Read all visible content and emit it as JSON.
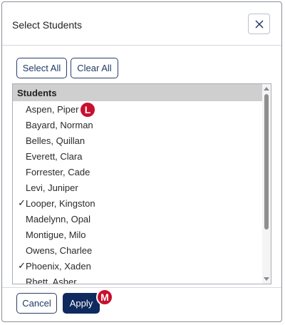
{
  "dialog": {
    "title": "Select Students",
    "close_icon": "close-icon"
  },
  "toolbar": {
    "select_all_label": "Select All",
    "clear_all_label": "Clear All"
  },
  "list": {
    "header": "Students",
    "items": [
      {
        "label": "Aspen, Piper",
        "checked": false,
        "check": ""
      },
      {
        "label": "Bayard, Norman",
        "checked": false,
        "check": ""
      },
      {
        "label": "Belles, Quillan",
        "checked": false,
        "check": ""
      },
      {
        "label": "Everett, Clara",
        "checked": false,
        "check": ""
      },
      {
        "label": "Forrester, Cade",
        "checked": false,
        "check": ""
      },
      {
        "label": "Levi, Juniper",
        "checked": false,
        "check": ""
      },
      {
        "label": "Looper, Kingston",
        "checked": true,
        "check": "✓"
      },
      {
        "label": "Madelynn, Opal",
        "checked": false,
        "check": ""
      },
      {
        "label": "Montigue, Milo",
        "checked": false,
        "check": ""
      },
      {
        "label": "Owens, Charlee",
        "checked": false,
        "check": ""
      },
      {
        "label": "Phoenix, Xaden",
        "checked": true,
        "check": "✓"
      },
      {
        "label": "Rhett, Asher",
        "checked": false,
        "check": ""
      }
    ]
  },
  "callouts": {
    "l": "L",
    "m": "M"
  },
  "footer": {
    "cancel_label": "Cancel",
    "apply_label": "Apply"
  },
  "colors": {
    "primary": "#0f2a5e",
    "callout": "#c8102e",
    "header_bg": "#cfcfcf"
  }
}
